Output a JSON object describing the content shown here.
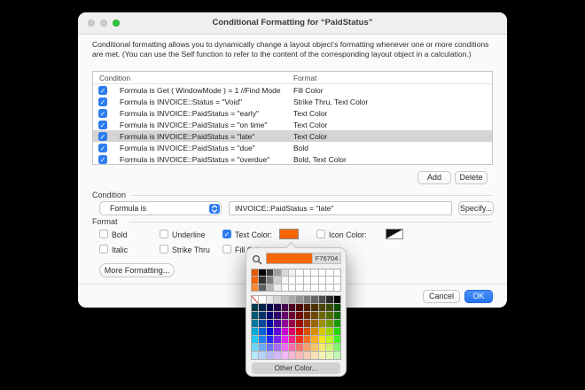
{
  "window": {
    "title": "Conditional Formatting for “PaidStatus”",
    "description": "Conditional formatting allows you to dynamically change a layout object’s formatting whenever one or more conditions are met.  (You can use the Self function to refer to the content of the corresponding layout object in a calculation.)"
  },
  "list": {
    "columns": {
      "condition": "Condition",
      "format": "Format"
    },
    "rows": [
      {
        "checked": true,
        "selected": false,
        "condition": "Formula is Get ( WindowMode ) = 1 //Find Mode",
        "format": "Fill Color"
      },
      {
        "checked": true,
        "selected": false,
        "condition": "Formula is INVOICE::Status = \"Void\"",
        "format": "Strike Thru, Text Color"
      },
      {
        "checked": true,
        "selected": false,
        "condition": "Formula is INVOICE::PaidStatus = \"early\"",
        "format": "Text Color"
      },
      {
        "checked": true,
        "selected": false,
        "condition": "Formula is INVOICE::PaidStatus = \"on time\"",
        "format": "Text Color"
      },
      {
        "checked": true,
        "selected": true,
        "condition": "Formula is INVOICE::PaidStatus = \"late\"",
        "format": "Text Color"
      },
      {
        "checked": true,
        "selected": false,
        "condition": "Formula is INVOICE::PaidStatus = \"due\"",
        "format": "Bold"
      },
      {
        "checked": true,
        "selected": false,
        "condition": "Formula is INVOICE::PaidStatus = \"overdue\"",
        "format": "Bold, Text Color"
      }
    ],
    "add_label": "Add",
    "delete_label": "Delete"
  },
  "condition_section": {
    "label": "Condition",
    "popup_value": "Formula is",
    "formula_value": "INVOICE::PaidStatus = \"late\"",
    "specify_label": "Specify..."
  },
  "format_section": {
    "label": "Format",
    "checkboxes": [
      {
        "label": "Bold",
        "checked": false
      },
      {
        "label": "Underline",
        "checked": false
      },
      {
        "label": "Text Color:",
        "checked": true
      },
      {
        "label": "Icon Color:",
        "checked": false
      },
      {
        "label": "Italic",
        "checked": false
      },
      {
        "label": "Strike Thru",
        "checked": false
      },
      {
        "label": "Fill Color:",
        "checked": false
      }
    ],
    "more_formatting_label": "More Formatting..."
  },
  "footer": {
    "cancel_label": "Cancel",
    "ok_label": "OK"
  },
  "color_picker": {
    "hex_value": "F76704",
    "current_color": "#f76704",
    "other_color_label": "Other Color...",
    "recent_rows": [
      [
        "#e05a00",
        "#000000",
        "#3c3c3c",
        "#9e9e9e",
        "#d8d8d8",
        "#f2f2f2",
        "#ffffff",
        "#ffffff",
        "#ffffff",
        "#ffffff",
        "#ffffff",
        "#ffffff"
      ],
      [
        "#f76704",
        "#2e2e2e",
        "#7d7d7d",
        "#cfcfcf",
        "#f5f5f5",
        "#ffffff",
        "#ffffff",
        "#ffffff",
        "#ffffff",
        "#ffffff",
        "#ffffff",
        "#ffffff"
      ],
      [
        "#f98a33",
        "#606060",
        "#b5b5b5",
        "#ededed",
        "#ffffff",
        "#ffffff",
        "#ffffff",
        "#ffffff",
        "#ffffff",
        "#ffffff",
        "#ffffff",
        "#ffffff"
      ]
    ],
    "palette": {
      "grayscale": [
        "none",
        "#ffffff",
        "#e9e9e9",
        "#d4d4d4",
        "#bfbfbf",
        "#a9a9a9",
        "#939393",
        "#7d7d7d",
        "#666666",
        "#4d4d4d",
        "#2b2b2b",
        "#000000"
      ],
      "hues": [
        193,
        213,
        238,
        266,
        296,
        332,
        4,
        22,
        40,
        56,
        76,
        110
      ],
      "row_lightness": [
        15,
        22,
        31,
        43,
        55,
        69,
        84
      ],
      "row_saturation": [
        95,
        95,
        95,
        95,
        90,
        85,
        80
      ]
    }
  },
  "colors": {
    "accent_blue": "#2d7cf0",
    "swatch_orange": "#f76704",
    "selection_gray": "#d5d4d4",
    "traffic_green": "#2dc63f"
  }
}
